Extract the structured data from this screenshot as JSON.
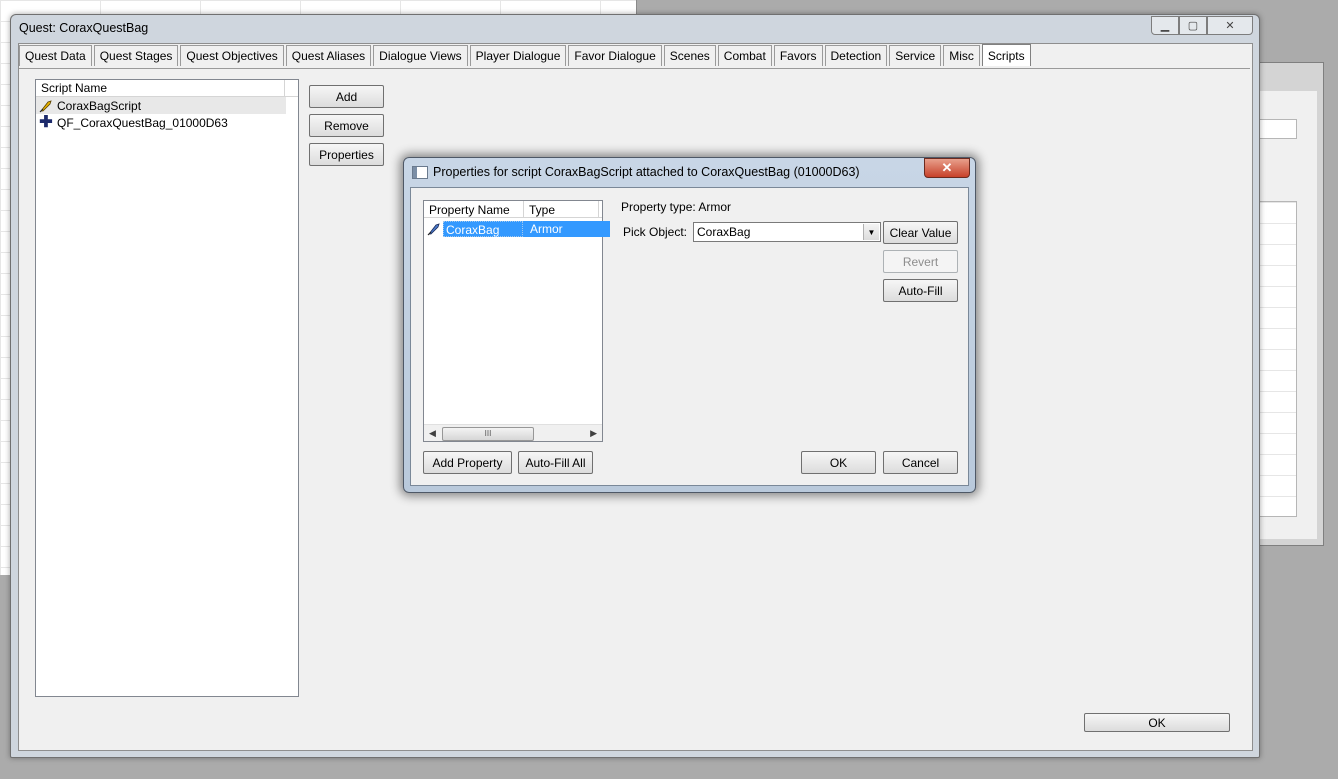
{
  "main_window": {
    "title": "Quest: CoraxQuestBag",
    "tabs": [
      {
        "label": "Quest Data"
      },
      {
        "label": "Quest Stages"
      },
      {
        "label": "Quest Objectives"
      },
      {
        "label": "Quest Aliases"
      },
      {
        "label": "Dialogue Views"
      },
      {
        "label": "Player Dialogue"
      },
      {
        "label": "Favor Dialogue"
      },
      {
        "label": "Scenes"
      },
      {
        "label": "Combat"
      },
      {
        "label": "Favors"
      },
      {
        "label": "Detection"
      },
      {
        "label": "Service"
      },
      {
        "label": "Misc"
      },
      {
        "label": "Scripts"
      }
    ],
    "active_tab": "Scripts",
    "script_list": {
      "header": "Script Name",
      "items": [
        {
          "name": "CoraxBagScript",
          "icon": "quill-icon"
        },
        {
          "name": "QF_CoraxQuestBag_01000D63",
          "icon": "plus-icon"
        }
      ]
    },
    "buttons": {
      "add": "Add",
      "remove": "Remove",
      "properties": "Properties",
      "ok": "OK"
    }
  },
  "dialog": {
    "title": "Properties for script CoraxBagScript attached to CoraxQuestBag (01000D63)",
    "close": "✕",
    "property_list": {
      "col_name": "Property Name",
      "col_type": "Type",
      "rows": [
        {
          "name": "CoraxBag",
          "type": "Armor"
        }
      ],
      "scroll_thumb": "III"
    },
    "property_type_label": "Property type: Armor",
    "pick_object_label": "Pick Object:",
    "pick_object_value": "CoraxBag",
    "buttons": {
      "clear_value": "Clear Value",
      "revert": "Revert",
      "auto_fill": "Auto-Fill",
      "add_property": "Add Property",
      "auto_fill_all": "Auto-Fill All",
      "ok": "OK",
      "cancel": "Cancel"
    }
  },
  "colors": {
    "selection": "#3399ff",
    "window_frame": "#cfd6de",
    "client_bg": "#f0f0f0",
    "close_button": "#c7412a"
  }
}
